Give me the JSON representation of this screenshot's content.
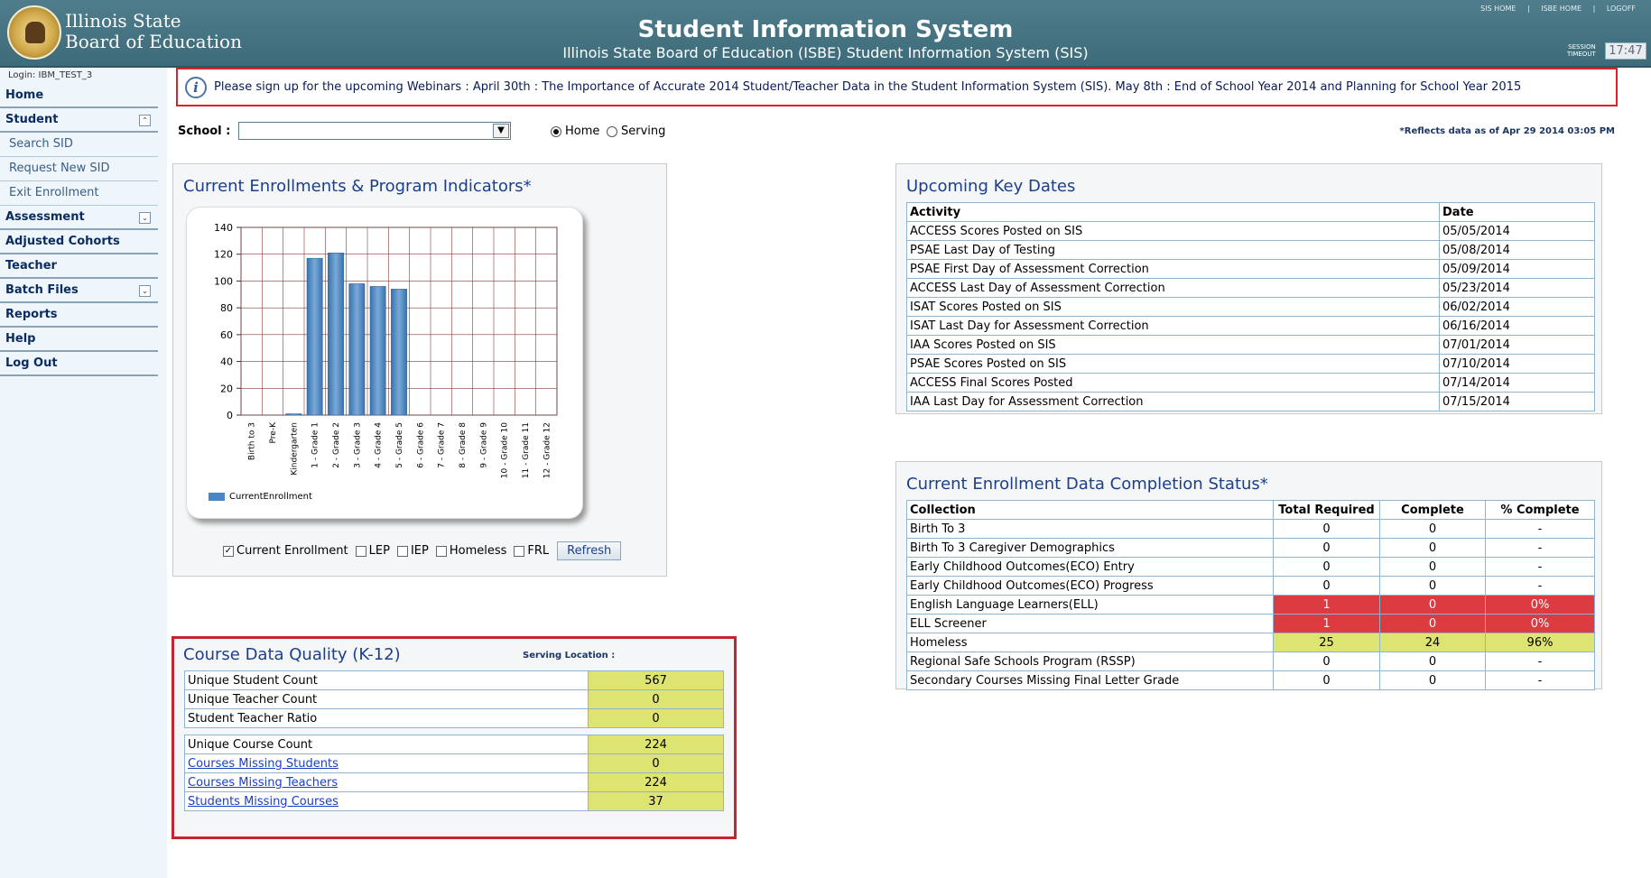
{
  "header": {
    "logo_line1": "Illinois State",
    "logo_line2": "Board of Education",
    "title": "Student Information System",
    "subtitle": "Illinois State Board of Education (ISBE) Student Information System (SIS)",
    "links": [
      "SIS HOME",
      "|",
      "ISBE HOME",
      "|",
      "LOGOFF"
    ],
    "session_label_1": "SESSION",
    "session_label_2": "TIMEOUT",
    "session_time": "17:47"
  },
  "sidebar": {
    "login": "Login: IBM_TEST_3",
    "items": [
      {
        "label": "Home"
      },
      {
        "label": "Student",
        "icon": "collapse-icon"
      },
      {
        "label": "Search SID"
      },
      {
        "label": "Request New SID"
      },
      {
        "label": "Exit Enrollment"
      },
      {
        "label": "Assessment",
        "icon": "expand-icon"
      },
      {
        "label": "Adjusted Cohorts"
      },
      {
        "label": "Teacher"
      },
      {
        "label": "Batch Files",
        "icon": "expand-icon"
      },
      {
        "label": "Reports"
      },
      {
        "label": "Help"
      },
      {
        "label": "Log Out"
      }
    ]
  },
  "banner": {
    "icon": "info-icon",
    "text": "Please sign up for the upcoming Webinars : April 30th : The Importance of Accurate 2014 Student/Teacher Data in the Student Information System (SIS). May 8th : End of School Year 2014 and Planning for School Year 2015"
  },
  "school": {
    "label": "School :",
    "value": "",
    "radio_home": "Home",
    "radio_serving": "Serving",
    "selected": "Home",
    "asof": "*Reflects data as of Apr 29 2014 03:05 PM"
  },
  "enroll_panel": {
    "title": "Current Enrollments & Program Indicators*",
    "legend": "CurrentEnrollment",
    "checks": [
      {
        "label": "Current Enrollment",
        "checked": true
      },
      {
        "label": "LEP",
        "checked": false
      },
      {
        "label": "IEP",
        "checked": false
      },
      {
        "label": "Homeless",
        "checked": false
      },
      {
        "label": "FRL",
        "checked": false
      }
    ],
    "refresh": "Refresh"
  },
  "chart_data": {
    "type": "bar",
    "categories": [
      "Birth to 3",
      "Pre-K",
      "Kindergarten",
      "1 - Grade 1",
      "2 - Grade 2",
      "3 - Grade 3",
      "4 - Grade 4",
      "5 - Grade 5",
      "6 - Grade 6",
      "7 - Grade 7",
      "8 - Grade 8",
      "9 - Grade 9",
      "10 - Grade 10",
      "11 - Grade 11",
      "12 - Grade 12"
    ],
    "series": [
      {
        "name": "CurrentEnrollment",
        "values": [
          0,
          0,
          1,
          117,
          121,
          98,
          96,
          94,
          0,
          0,
          0,
          0,
          0,
          0,
          0
        ]
      }
    ],
    "ylim": [
      0,
      140
    ],
    "yticks": [
      0,
      20,
      40,
      60,
      80,
      100,
      120,
      140
    ],
    "grid": true,
    "legend": "bottom-left",
    "color": "#4a86c6"
  },
  "key_dates": {
    "title": "Upcoming Key Dates",
    "headers": [
      "Activity",
      "Date"
    ],
    "rows": [
      [
        "ACCESS Scores Posted on SIS",
        "05/05/2014"
      ],
      [
        "PSAE Last Day of Testing",
        "05/08/2014"
      ],
      [
        "PSAE First Day of Assessment Correction",
        "05/09/2014"
      ],
      [
        "ACCESS Last Day of Assessment Correction",
        "05/23/2014"
      ],
      [
        "ISAT Scores Posted on SIS",
        "06/02/2014"
      ],
      [
        "ISAT Last Day for Assessment Correction",
        "06/16/2014"
      ],
      [
        "IAA Scores Posted on SIS",
        "07/01/2014"
      ],
      [
        "PSAE Scores Posted on SIS",
        "07/10/2014"
      ],
      [
        "ACCESS Final Scores Posted",
        "07/14/2014"
      ],
      [
        "IAA Last Day for Assessment Correction",
        "07/15/2014"
      ]
    ]
  },
  "completion": {
    "title": "Current Enrollment Data Completion Status*",
    "headers": [
      "Collection",
      "Total Required",
      "Complete",
      "% Complete"
    ],
    "rows": [
      {
        "cells": [
          "Birth To 3",
          "0",
          "0",
          "-"
        ],
        "status": ""
      },
      {
        "cells": [
          "Birth To 3 Caregiver Demographics",
          "0",
          "0",
          "-"
        ],
        "status": ""
      },
      {
        "cells": [
          "Early Childhood Outcomes(ECO) Entry",
          "0",
          "0",
          "-"
        ],
        "status": ""
      },
      {
        "cells": [
          "Early Childhood Outcomes(ECO) Progress",
          "0",
          "0",
          "-"
        ],
        "status": ""
      },
      {
        "cells": [
          "English Language Learners(ELL)",
          "1",
          "0",
          "0%"
        ],
        "status": "red"
      },
      {
        "cells": [
          "ELL Screener",
          "1",
          "0",
          "0%"
        ],
        "status": "red"
      },
      {
        "cells": [
          "Homeless",
          "25",
          "24",
          "96%"
        ],
        "status": "yel"
      },
      {
        "cells": [
          "Regional Safe Schools Program (RSSP)",
          "0",
          "0",
          "-"
        ],
        "status": ""
      },
      {
        "cells": [
          "Secondary Courses Missing Final Letter Grade",
          "0",
          "0",
          "-"
        ],
        "status": ""
      }
    ],
    "colors": {
      "red": "#dc3b42",
      "yellow": "#dde472"
    }
  },
  "course_quality": {
    "title": "Course Data Quality (K-12)",
    "serving": "Serving Location :",
    "group1": [
      {
        "label": "Unique Student Count",
        "value": "567",
        "link": false
      },
      {
        "label": "Unique Teacher Count",
        "value": "0",
        "link": false
      },
      {
        "label": "Student Teacher Ratio",
        "value": "0",
        "link": false
      }
    ],
    "group2": [
      {
        "label": "Unique Course Count",
        "value": "224",
        "link": false
      },
      {
        "label": "Courses Missing Students",
        "value": "0",
        "link": true
      },
      {
        "label": "Courses Missing Teachers",
        "value": "224",
        "link": true
      },
      {
        "label": "Students Missing Courses",
        "value": "37",
        "link": true
      }
    ]
  }
}
